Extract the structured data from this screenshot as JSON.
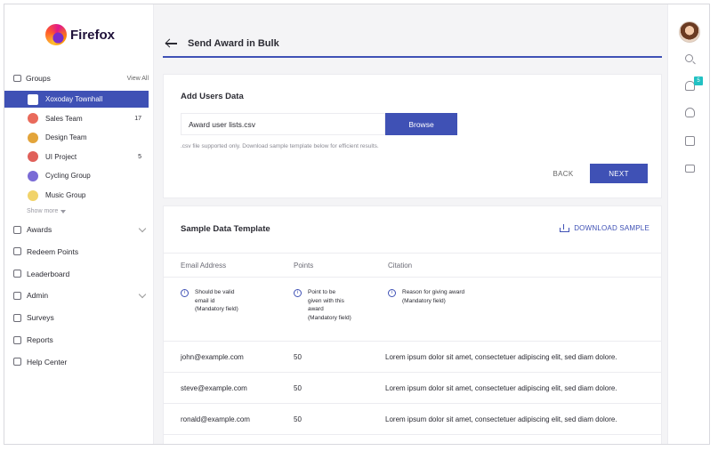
{
  "brand": {
    "name": "Firefox"
  },
  "sidebar": {
    "groups_label": "Groups",
    "view_all": "View All",
    "groups": [
      {
        "name": "Xoxoday Townhall",
        "count": "",
        "active": true,
        "color": "#ffffff"
      },
      {
        "name": "Sales Team",
        "count": "17",
        "active": false,
        "color": "#e96a5b"
      },
      {
        "name": "Design Team",
        "count": "",
        "active": false,
        "color": "#e3a43a"
      },
      {
        "name": "UI Project",
        "count": "5",
        "active": false,
        "color": "#e0605a"
      },
      {
        "name": "Cycling Group",
        "count": "",
        "active": false,
        "color": "#7a6bd6"
      },
      {
        "name": "Music Group",
        "count": "",
        "active": false,
        "color": "#f1d36a"
      }
    ],
    "show_more": "Show more",
    "nav": [
      {
        "label": "Awards",
        "chevron": true
      },
      {
        "label": "Redeem Points",
        "chevron": false
      },
      {
        "label": "Leaderboard",
        "chevron": false
      },
      {
        "label": "Admin",
        "chevron": true
      },
      {
        "label": "Surveys",
        "chevron": false
      },
      {
        "label": "Reports",
        "chevron": false
      },
      {
        "label": "Help Center",
        "chevron": false
      }
    ]
  },
  "header": {
    "title": "Send Award in Bulk"
  },
  "add_users": {
    "title": "Add Users Data",
    "file_value": "Award user lists.csv",
    "browse_label": "Browse",
    "hint": ".csv file supported only. Download sample template below for efficient results.",
    "back_label": "BACK",
    "next_label": "NEXT"
  },
  "template": {
    "title": "Sample Data Template",
    "download_label": "DOWNLOAD SAMPLE",
    "columns": [
      "Email Address",
      "Points",
      "Citation"
    ],
    "notes": [
      "Should be valid\nemail id\n(Mandatory field)",
      "Point to be\ngiven with this\naward\n(Mandatory field)",
      "Reason for giving award\n(Mandatory field)"
    ],
    "rows": [
      {
        "email": "john@example.com",
        "points": "50",
        "citation": "Lorem ipsum dolor sit amet, consectetuer adipiscing elit, sed diam dolore."
      },
      {
        "email": "steve@example.com",
        "points": "50",
        "citation": "Lorem ipsum dolor sit amet, consectetuer adipiscing elit, sed diam dolore."
      },
      {
        "email": "ronald@example.com",
        "points": "50",
        "citation": "Lorem ipsum dolor sit amet, consectetuer adipiscing elit, sed diam dolore."
      }
    ]
  },
  "rail": {
    "notification_count": "5"
  },
  "colors": {
    "accent": "#3f51b5",
    "badge": "#22c1c3"
  }
}
